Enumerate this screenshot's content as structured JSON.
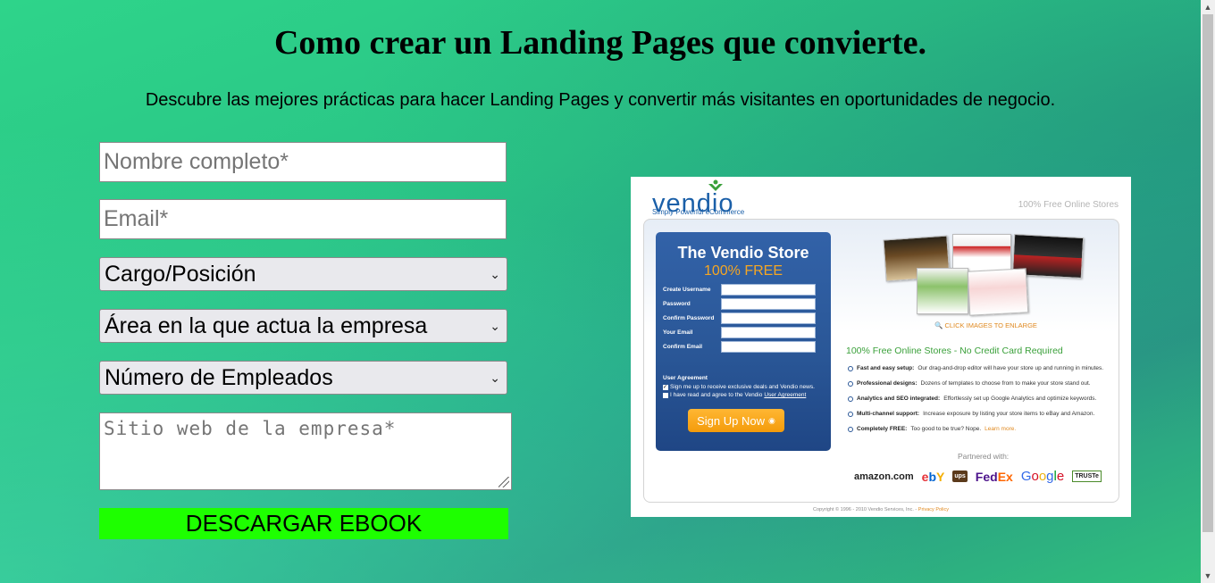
{
  "page": {
    "title": "Como crear un Landing Pages que convierte.",
    "subtitle": "Descubre las mejores prácticas para hacer Landing Pages y convertir más visitantes en oportunidades de negocio."
  },
  "form": {
    "name_placeholder": "Nombre completo*",
    "email_placeholder": "Email*",
    "position_selected": "Cargo/Posición",
    "area_selected": "Área en la que actua la empresa",
    "employees_selected": "Número de Empleados",
    "website_placeholder": "Sitio web de la empresa*",
    "submit_label": "DESCARGAR EBOOK",
    "submit_color": "#1eff00"
  },
  "vendio_image": {
    "logo": "vendio",
    "logo_sub": "Simply Powerful eCommerce",
    "tagline": "100% Free Online Stores",
    "signup_title": "The Vendio Store",
    "signup_free": "100% FREE",
    "fields": [
      "Create Username",
      "Password",
      "Confirm Password",
      "Your Email",
      "Confirm Email"
    ],
    "user_agreement": "User Agreement",
    "check1": "Sign me up to receive exclusive deals and Vendio news.",
    "check2_prefix": "I have read and agree to the Vendio",
    "check2_link": "User Agreement",
    "signup_button": "Sign Up Now",
    "click_images": "CLICK IMAGES TO ENLARGE",
    "headline": "100% Free Online Stores - No Credit Card Required",
    "features": [
      {
        "bold": "Fast and easy setup:",
        "text": "Our drag-and-drop editor will have your store up and running in minutes."
      },
      {
        "bold": "Professional designs:",
        "text": "Dozens of templates to choose from to make your store stand out."
      },
      {
        "bold": "Analytics and SEO integrated:",
        "text": "Effortlessly set up Google Analytics and optimize keywords."
      },
      {
        "bold": "Multi-channel support:",
        "text": "Increase exposure by listing your store items to eBay and Amazon."
      },
      {
        "bold": "Completely FREE:",
        "text": "Too good to be true? Nope.",
        "link": "Learn more."
      }
    ],
    "partnered": "Partnered with:",
    "partners": [
      "amazon.com",
      "ebY",
      "ups",
      "FedEx",
      "Google",
      "TRUSTe"
    ],
    "copyright": "Copyright © 1996 - 2010 Vendio Services, Inc. -",
    "privacy": "Privacy Policy"
  }
}
